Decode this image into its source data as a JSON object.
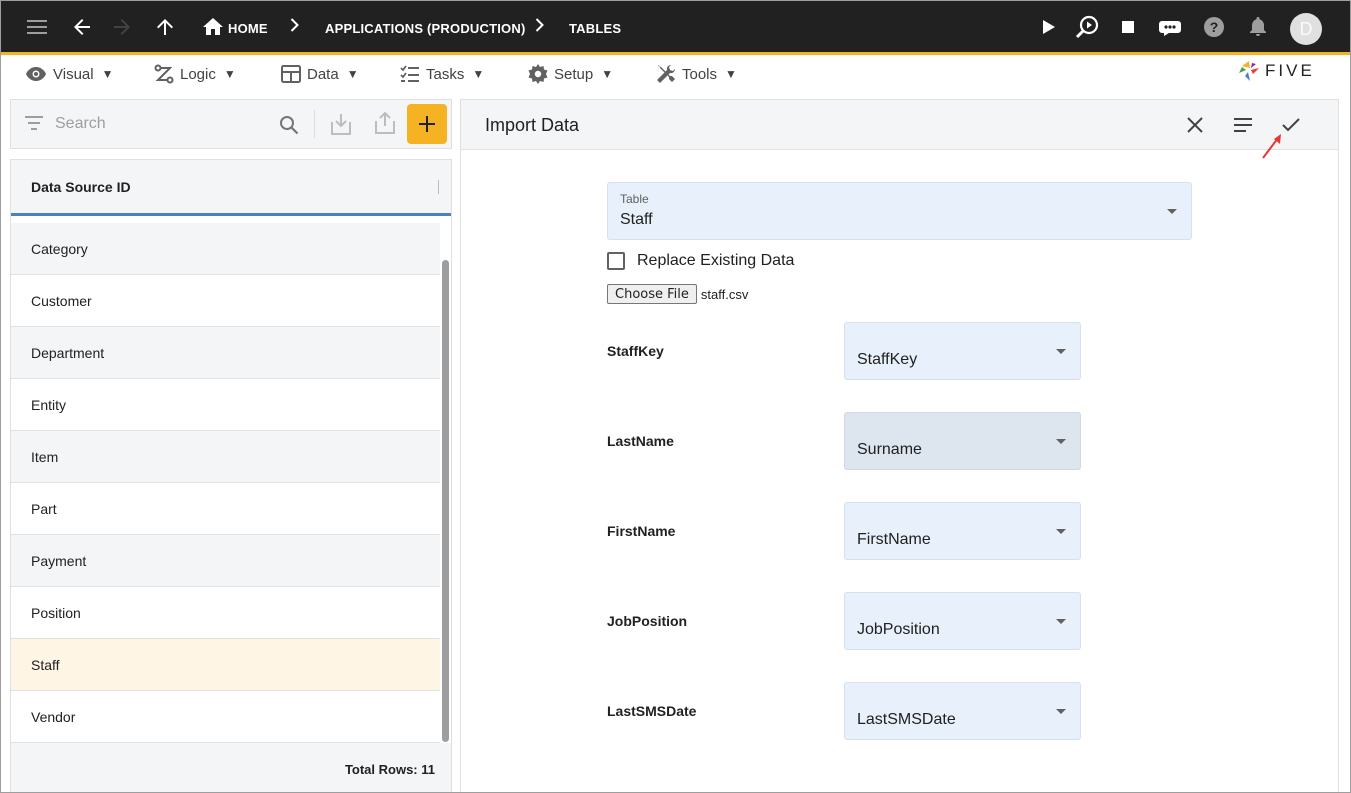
{
  "topbar": {
    "breadcrumb": [
      "HOME",
      "APPLICATIONS (PRODUCTION)",
      "TABLES"
    ],
    "avatar_initial": "D"
  },
  "menu": {
    "items": [
      "Visual",
      "Logic",
      "Data",
      "Tasks",
      "Setup",
      "Tools"
    ],
    "caret": "▼",
    "brand": "FIVE"
  },
  "list": {
    "search_placeholder": "Search",
    "column_header": "Data Source ID",
    "rows": [
      "Category",
      "Customer",
      "Department",
      "Entity",
      "Item",
      "Part",
      "Payment",
      "Position",
      "Staff",
      "Vendor"
    ],
    "selected": "Staff",
    "total_rows": "Total Rows: 11"
  },
  "form": {
    "title": "Import Data",
    "table_label": "Table",
    "table_value": "Staff",
    "replace_label": "Replace Existing Data",
    "replace_checked": false,
    "choose_file_label": "Choose File",
    "file_name": "staff.csv",
    "mappings": [
      {
        "field": "StaffKey",
        "column": "StaffKey"
      },
      {
        "field": "LastName",
        "column": "Surname"
      },
      {
        "field": "FirstName",
        "column": "FirstName"
      },
      {
        "field": "JobPosition",
        "column": "JobPosition"
      },
      {
        "field": "LastSMSDate",
        "column": "LastSMSDate"
      }
    ]
  },
  "colors": {
    "topbar_bg": "#212121",
    "accent": "#f5b324",
    "header_underline": "#4a7fc1",
    "field_bg": "#e8f0fb",
    "selected_row": "#fff5e5",
    "annotation_arrow": "#e53935"
  }
}
